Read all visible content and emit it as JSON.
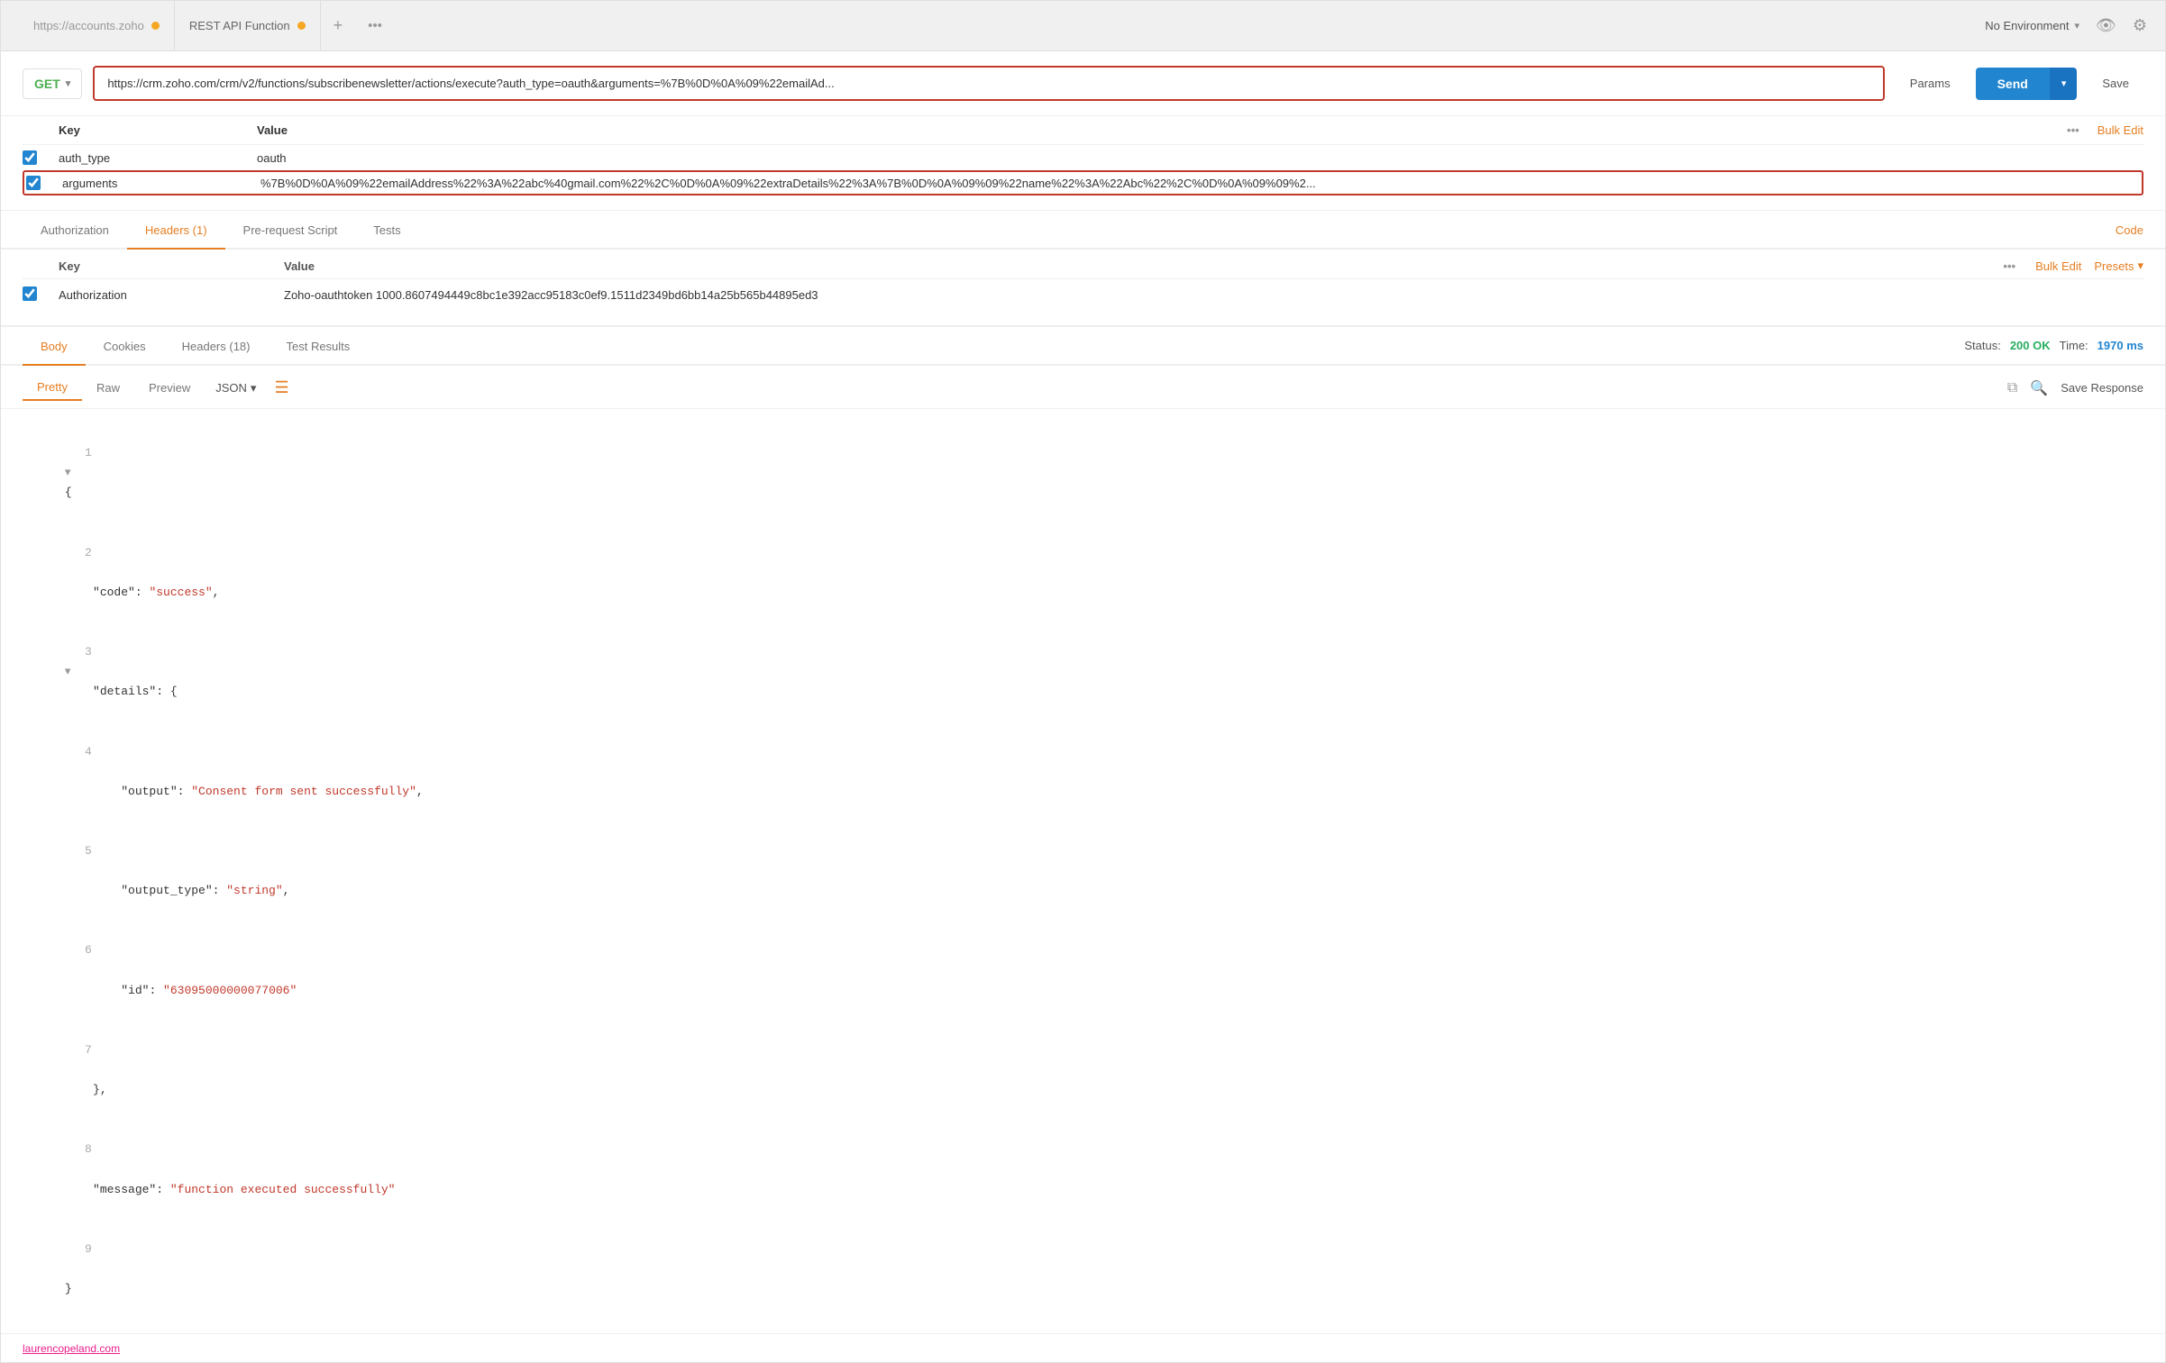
{
  "tabs": [
    {
      "label": "https://accounts.zoho",
      "dot": true,
      "active": false
    },
    {
      "label": "REST API Function",
      "dot": true,
      "active": true
    }
  ],
  "tab_add": "+",
  "tab_more": "•••",
  "env_selector": {
    "label": "No Environment",
    "chevron": "▾"
  },
  "request": {
    "method": "GET",
    "url": "https://crm.zoho.com/crm/v2/functions/subscribenewsletter/actions/execute?auth_type=oauth&arguments=%7B%0D%0A%09%22emailAd...",
    "params_btn": "Params",
    "send_btn": "Send",
    "save_btn": "Save"
  },
  "params": {
    "headers": {
      "key": "Key",
      "value": "Value",
      "bulk_edit": "Bulk Edit"
    },
    "rows": [
      {
        "checked": true,
        "key": "auth_type",
        "value": "oauth"
      },
      {
        "checked": true,
        "key": "arguments",
        "value": "%7B%0D%0A%09%22emailAddress%22%3A%22abc%40gmail.com%22%2C%0D%0A%09%22extraDetails%22%3A%7B%0D%0A%09%09%22name%22%3A%22Abc%22%2C%0D%0A%09%09%2...",
        "highlighted": true
      }
    ],
    "dots": "•••"
  },
  "section_tabs": {
    "tabs": [
      {
        "label": "Authorization",
        "active": false
      },
      {
        "label": "Headers (1)",
        "active": true
      },
      {
        "label": "Pre-request Script",
        "active": false
      },
      {
        "label": "Tests",
        "active": false
      }
    ],
    "right_action": "Code"
  },
  "headers_section": {
    "headers": {
      "key": "Key",
      "value": "Value",
      "bulk_edit": "Bulk Edit",
      "presets": "Presets"
    },
    "rows": [
      {
        "checked": true,
        "key": "Authorization",
        "value": "Zoho-oauthtoken 1000.8607494449c8bc1e392acc95183c0ef9.1511d2349bd6bb14a25b565b44895ed3"
      }
    ],
    "dots": "•••"
  },
  "response": {
    "tabs": [
      {
        "label": "Body",
        "active": true
      },
      {
        "label": "Cookies",
        "active": false
      },
      {
        "label": "Headers (18)",
        "active": false
      },
      {
        "label": "Test Results",
        "active": false
      }
    ],
    "status_label": "Status:",
    "status_value": "200 OK",
    "time_label": "Time:",
    "time_value": "1970 ms"
  },
  "format_bar": {
    "tabs": [
      {
        "label": "Pretty",
        "active": true
      },
      {
        "label": "Raw",
        "active": false
      },
      {
        "label": "Preview",
        "active": false
      }
    ],
    "json_select": "JSON",
    "save_response": "Save Response"
  },
  "json_lines": [
    {
      "num": "1",
      "indent": 0,
      "content": "{",
      "collapse": true
    },
    {
      "num": "2",
      "indent": 1,
      "content": "\"code\": \"success\","
    },
    {
      "num": "3",
      "indent": 1,
      "content": "\"details\": {",
      "collapse": true
    },
    {
      "num": "4",
      "indent": 2,
      "content": "\"output\": \"Consent form sent successfully\","
    },
    {
      "num": "5",
      "indent": 2,
      "content": "\"output_type\": \"string\","
    },
    {
      "num": "6",
      "indent": 2,
      "content": "\"id\": \"63095000000077006\""
    },
    {
      "num": "7",
      "indent": 1,
      "content": "},"
    },
    {
      "num": "8",
      "indent": 1,
      "content": "\"message\": \"function executed successfully\""
    },
    {
      "num": "9",
      "indent": 0,
      "content": "}"
    }
  ],
  "footer": {
    "link_text": "laurencopeland.com"
  }
}
